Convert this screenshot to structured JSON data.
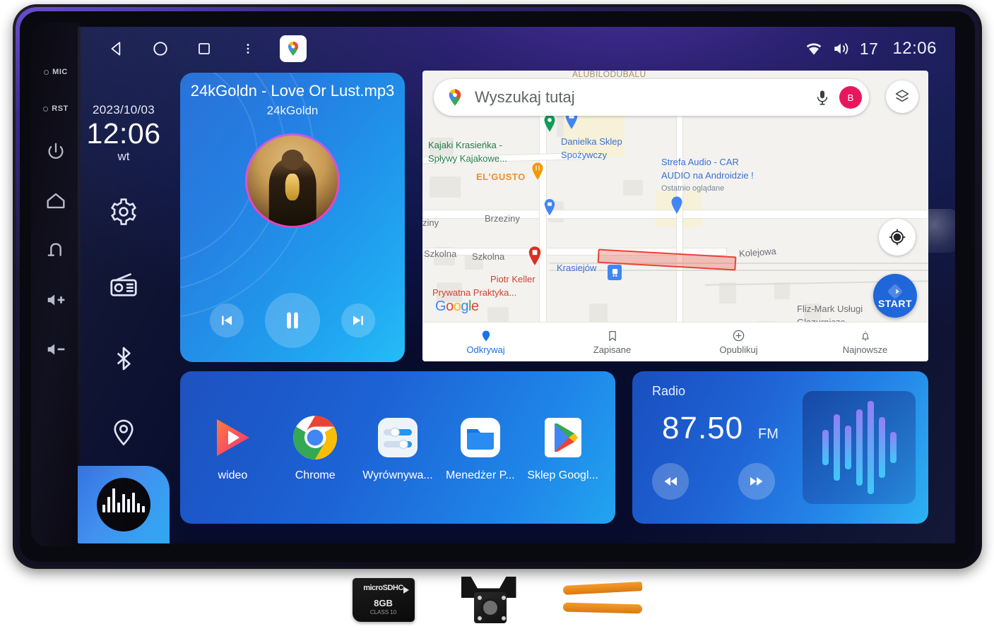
{
  "device": {
    "hardware_buttons": [
      {
        "name": "mic-pinhole",
        "label": "MIC"
      },
      {
        "name": "reset-pinhole",
        "label": "RST"
      },
      {
        "name": "power-button",
        "label": "power-icon"
      },
      {
        "name": "home-button",
        "label": "home-icon"
      },
      {
        "name": "back-button",
        "label": "back-icon"
      },
      {
        "name": "volume-up-button",
        "label": "volume-up-icon"
      },
      {
        "name": "volume-down-button",
        "label": "volume-down-icon"
      }
    ]
  },
  "statusbar": {
    "nav": [
      {
        "name": "android-back",
        "icon": "triangle-left-icon"
      },
      {
        "name": "android-home",
        "icon": "circle-icon"
      },
      {
        "name": "android-recents",
        "icon": "square-icon"
      },
      {
        "name": "android-overflow",
        "icon": "kebab-menu-icon"
      }
    ],
    "active_app_icon": "google-maps-icon",
    "wifi_icon": "wifi-icon",
    "volume_icon": "speaker-icon",
    "volume_level": "17",
    "clock": "12:06"
  },
  "left_rail": {
    "date": "2023/10/03",
    "time": "12:06",
    "weekday": "wt",
    "items": [
      {
        "name": "settings",
        "icon": "gear-icon"
      },
      {
        "name": "radio",
        "icon": "radio-icon"
      },
      {
        "name": "bluetooth",
        "icon": "bluetooth-icon"
      },
      {
        "name": "navigation",
        "icon": "location-pin-icon"
      }
    ],
    "music_shortcut": {
      "name": "music-shortcut",
      "icon": "audio-waveform-icon"
    }
  },
  "player": {
    "track_title": "24kGoldn - Love Or Lust.mp3",
    "artist": "24kGoldn",
    "album_art": "24kgoldn-album-cover",
    "controls": [
      {
        "name": "previous-track",
        "icon": "skip-previous-icon"
      },
      {
        "name": "play-pause",
        "icon": "pause-icon"
      },
      {
        "name": "next-track",
        "icon": "skip-next-icon"
      }
    ]
  },
  "map": {
    "search": {
      "placeholder": "Wyszukaj tutaj",
      "leading_icon": "google-maps-pin-icon",
      "mic_icon": "microphone-icon",
      "avatar_initial": "B"
    },
    "layers_icon": "map-layers-icon",
    "locate_icon": "my-location-icon",
    "start_button": {
      "label": "START",
      "icon": "navigation-arrow-icon"
    },
    "cut_off_top_label": "ALUBILODUBALU",
    "labels": [
      {
        "text": "Kajaki Krasieńka -",
        "style": "green"
      },
      {
        "text": "Spływy Kajakowe...",
        "style": "green"
      },
      {
        "text": "Danielka Sklep",
        "style": "blue"
      },
      {
        "text": "Spożywczy",
        "style": "blue"
      },
      {
        "text": "Strefa Audio - CAR",
        "style": "blue"
      },
      {
        "text": "AUDIO na Androidzie !",
        "style": "blue"
      },
      {
        "text": "Ostatnio oglądane",
        "style": "sub"
      },
      {
        "text": "EL'GUSTO",
        "style": "orange"
      },
      {
        "text": "ziny",
        "style": "street"
      },
      {
        "text": "Brzeziny",
        "style": "street"
      },
      {
        "text": "Szkolna",
        "style": "street"
      },
      {
        "text": "Szkolna",
        "style": "street"
      },
      {
        "text": "Kolejowa",
        "style": "street"
      },
      {
        "text": "Krasiejów",
        "style": "blue"
      },
      {
        "text": "Piotr Keller",
        "style": "red"
      },
      {
        "text": "Prywatna Praktyka...",
        "style": "red"
      },
      {
        "text": "Fliz-Mark Usługi",
        "style": "street"
      },
      {
        "text": "Glazurnicze",
        "style": "street"
      }
    ],
    "attribution": "Google",
    "bottom_nav": [
      {
        "label": "Odkrywaj",
        "icon": "explore-pin-icon",
        "active": true
      },
      {
        "label": "Zapisane",
        "icon": "bookmark-icon",
        "active": false
      },
      {
        "label": "Opublikuj",
        "icon": "plus-circle-icon",
        "active": false
      },
      {
        "label": "Najnowsze",
        "icon": "bell-icon",
        "active": false
      }
    ]
  },
  "shortcuts": [
    {
      "label": "wideo",
      "icon": "video-player-icon"
    },
    {
      "label": "Chrome",
      "icon": "chrome-icon"
    },
    {
      "label": "Wyrównywa...",
      "icon": "equalizer-icon"
    },
    {
      "label": "Menedżer P...",
      "icon": "file-manager-folder-icon"
    },
    {
      "label": "Sklep Googl...",
      "icon": "google-play-icon"
    }
  ],
  "radio": {
    "title": "Radio",
    "frequency": "87.50",
    "band": "FM",
    "prev_icon": "rewind-icon",
    "next_icon": "fast-forward-icon",
    "visualizer_icon": "audio-bars-icon"
  },
  "accessories": [
    {
      "name": "micro-sd-card",
      "brand": "microSDHC",
      "capacity": "8GB",
      "class": "CLASS 10"
    },
    {
      "name": "reversing-camera",
      "label": "rear-view-camera"
    },
    {
      "name": "pry-tools",
      "label": "plastic-trim-tools"
    }
  ],
  "colors": {
    "accent_blue": "#1a73e8",
    "panel_blue": "#1d63d6",
    "cyan": "#23aff2",
    "avatar_pink": "#e8175d",
    "route_red": "#ea4335"
  }
}
